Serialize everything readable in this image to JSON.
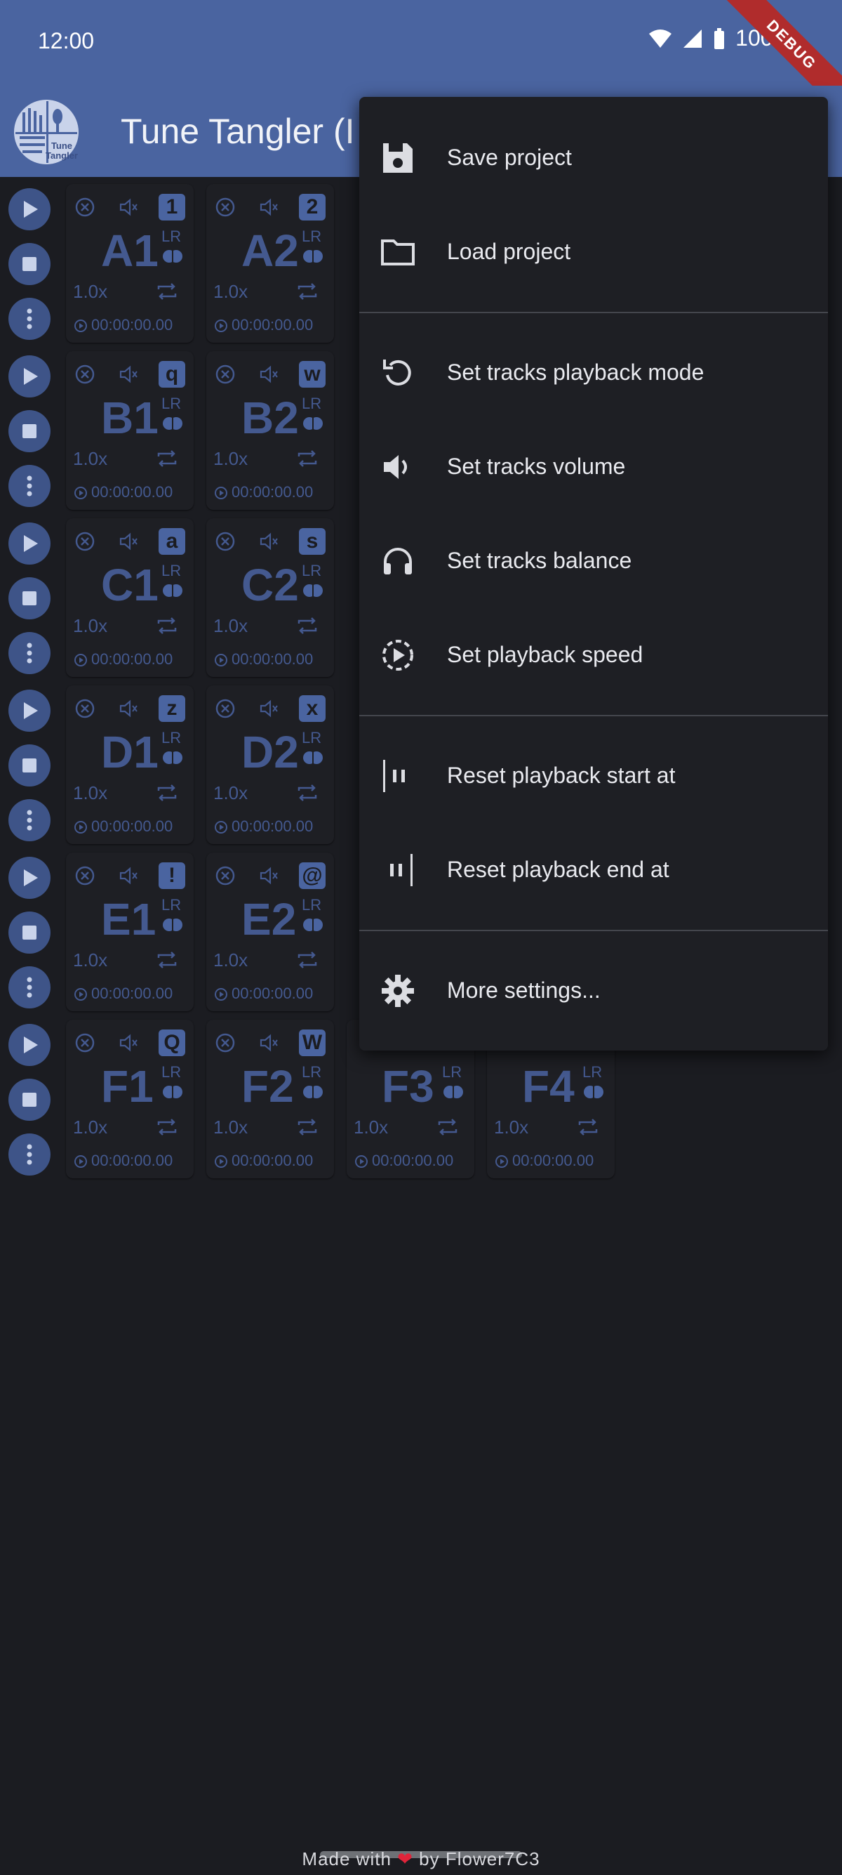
{
  "status": {
    "time": "12:00",
    "battery": "100%",
    "debug_label": "DEBUG"
  },
  "app": {
    "title": "Tune Tangler (I",
    "logo_text": "Tune Tangler"
  },
  "rows": [
    {
      "cells": [
        {
          "name": "A1",
          "key": "1",
          "speed": "1.0x",
          "lr": "LR",
          "time": "00:00:00.00"
        },
        {
          "name": "A2",
          "key": "2",
          "speed": "1.0x",
          "lr": "LR",
          "time": "00:00:00.00"
        }
      ]
    },
    {
      "cells": [
        {
          "name": "B1",
          "key": "q",
          "speed": "1.0x",
          "lr": "LR",
          "time": "00:00:00.00"
        },
        {
          "name": "B2",
          "key": "w",
          "speed": "1.0x",
          "lr": "LR",
          "time": "00:00:00.00"
        }
      ]
    },
    {
      "cells": [
        {
          "name": "C1",
          "key": "a",
          "speed": "1.0x",
          "lr": "LR",
          "time": "00:00:00.00"
        },
        {
          "name": "C2",
          "key": "s",
          "speed": "1.0x",
          "lr": "LR",
          "time": "00:00:00.00"
        }
      ]
    },
    {
      "cells": [
        {
          "name": "D1",
          "key": "z",
          "speed": "1.0x",
          "lr": "LR",
          "time": "00:00:00.00"
        },
        {
          "name": "D2",
          "key": "x",
          "speed": "1.0x",
          "lr": "LR",
          "time": "00:00:00.00"
        }
      ]
    },
    {
      "cells": [
        {
          "name": "E1",
          "key": "!",
          "speed": "1.0x",
          "lr": "LR",
          "time": "00:00:00.00"
        },
        {
          "name": "E2",
          "key": "@",
          "speed": "1.0x",
          "lr": "LR",
          "time": "00:00:00.00"
        }
      ]
    },
    {
      "cells": [
        {
          "name": "F1",
          "key": "Q",
          "speed": "1.0x",
          "lr": "LR",
          "time": "00:00:00.00"
        },
        {
          "name": "F2",
          "key": "W",
          "speed": "1.0x",
          "lr": "LR",
          "time": "00:00:00.00"
        },
        {
          "name": "F3",
          "key": "",
          "speed": "1.0x",
          "lr": "LR",
          "time": "00:00:00.00"
        },
        {
          "name": "F4",
          "key": "",
          "speed": "1.0x",
          "lr": "LR",
          "time": "00:00:00.00"
        }
      ]
    }
  ],
  "menu": {
    "items": [
      {
        "label": "Save project",
        "icon": "save-icon"
      },
      {
        "label": "Load project",
        "icon": "folder-icon"
      },
      {
        "label": "Set tracks playback mode",
        "icon": "replay-icon"
      },
      {
        "label": "Set tracks volume",
        "icon": "volume-icon"
      },
      {
        "label": "Set tracks balance",
        "icon": "headphones-icon"
      },
      {
        "label": "Set playback speed",
        "icon": "playback-speed-icon"
      },
      {
        "label": "Reset playback start at",
        "icon": "start-marker-icon"
      },
      {
        "label": "Reset playback end at",
        "icon": "end-marker-icon"
      },
      {
        "label": "More settings...",
        "icon": "gear-icon"
      }
    ]
  },
  "footer": {
    "made_with": "Made with",
    "heart": "❤",
    "by": "by Flower7C3"
  },
  "colors": {
    "accent": "#4a64a0",
    "background": "#1b1c21",
    "menu": "#1e1f24",
    "muted_text": "#44598f"
  }
}
